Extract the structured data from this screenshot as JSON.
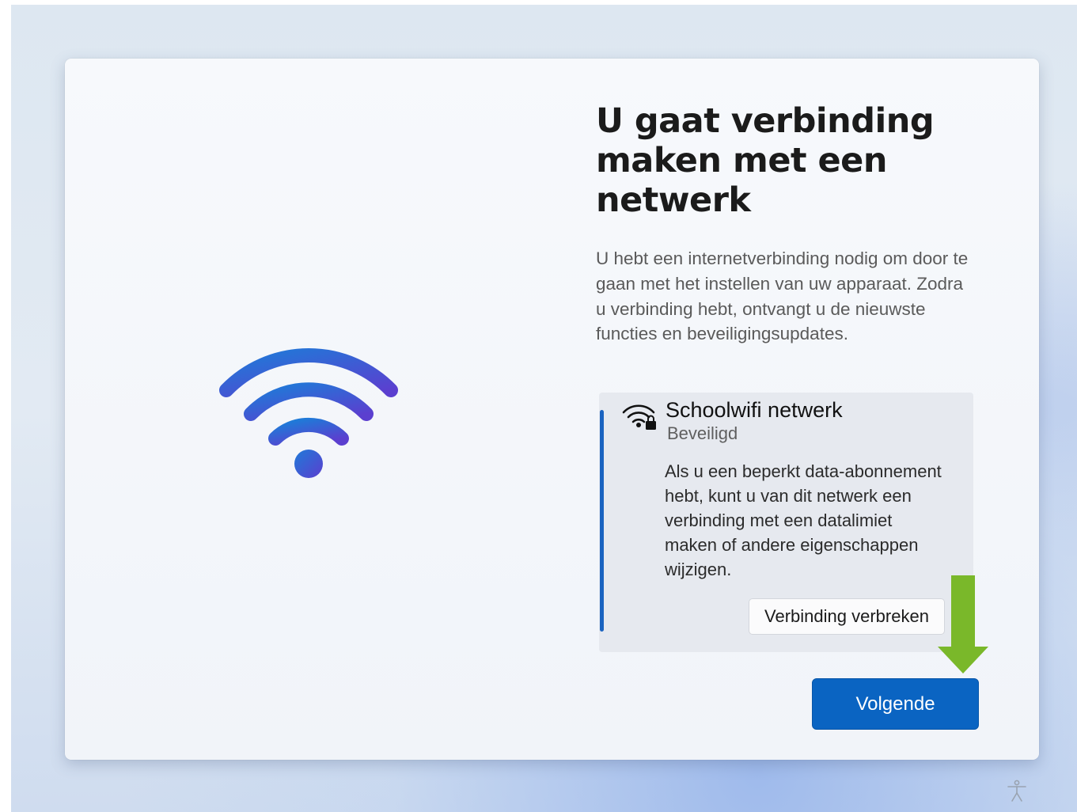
{
  "page": {
    "title": "U gaat verbinding maken met een netwerk",
    "description": "U hebt een internetverbinding nodig om door te gaan met het instellen van uw apparaat. Zodra u verbinding hebt, ontvangt u de nieuwste functies en beveiligingsupdates.",
    "hero_icon": "wifi-icon"
  },
  "network": {
    "name": "Schoolwifi netwerk",
    "status": "Beveiligd",
    "info": "Als u een beperkt data-abonnement hebt, kunt u van dit netwerk een verbinding met een datalimiet maken of andere eigenschappen wijzigen.",
    "disconnect_label": "Verbinding verbreken",
    "icon": "wifi-secured-icon"
  },
  "footer": {
    "next_label": "Volgende",
    "accessibility_icon": "accessibility-icon"
  },
  "annotation": {
    "icon": "arrow-down-icon",
    "color": "#7ab82a"
  },
  "colors": {
    "accent": "#0a64c2",
    "wifi_gradient_start": "#1f7ad8",
    "wifi_gradient_end": "#5b3fcf"
  }
}
